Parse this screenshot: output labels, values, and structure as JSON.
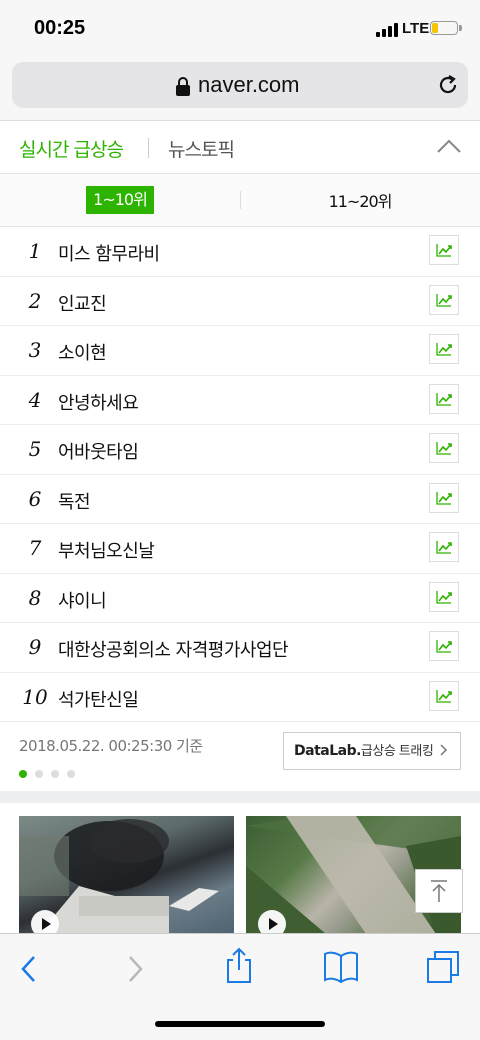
{
  "status_bar": {
    "time": "00:25",
    "network": "LTE",
    "battery_fill": 0.2
  },
  "address_bar": {
    "url": "naver.com"
  },
  "header_tabs": {
    "active": "실시간 급상승",
    "inactive": "뉴스토픽"
  },
  "range_tabs": {
    "active": "1~10위",
    "inactive": "11~20위"
  },
  "ranking": [
    {
      "rank": "1",
      "keyword": "미스 함무라비"
    },
    {
      "rank": "2",
      "keyword": "인교진"
    },
    {
      "rank": "3",
      "keyword": "소이현"
    },
    {
      "rank": "4",
      "keyword": "안녕하세요"
    },
    {
      "rank": "5",
      "keyword": "어바웃타임"
    },
    {
      "rank": "6",
      "keyword": "독전"
    },
    {
      "rank": "7",
      "keyword": "부처님오신날"
    },
    {
      "rank": "8",
      "keyword": "샤이니"
    },
    {
      "rank": "9",
      "keyword": "대한상공회의소 자격평가사업단"
    },
    {
      "rank": "10",
      "keyword": "석가탄신일"
    }
  ],
  "footer": {
    "timestamp": "2018.05.22. 00:25:30 기준",
    "datalab_brand": "DataLab.",
    "datalab_text": "급상승 트래킹",
    "page_dots": 4,
    "active_dot": 1
  },
  "colors": {
    "accent": "#2db400",
    "ios_blue": "#1a7ae6"
  },
  "icons": {
    "trend": "trend-chart-icon",
    "lock": "lock-icon",
    "reload": "reload-icon",
    "collapse": "chevron-up-icon",
    "play": "play-icon",
    "scroll_top": "arrow-up-to-top-icon",
    "back": "back-arrow-icon",
    "forward": "forward-arrow-icon",
    "share": "share-icon",
    "bookmarks": "book-icon",
    "tabs": "tabs-icon"
  }
}
